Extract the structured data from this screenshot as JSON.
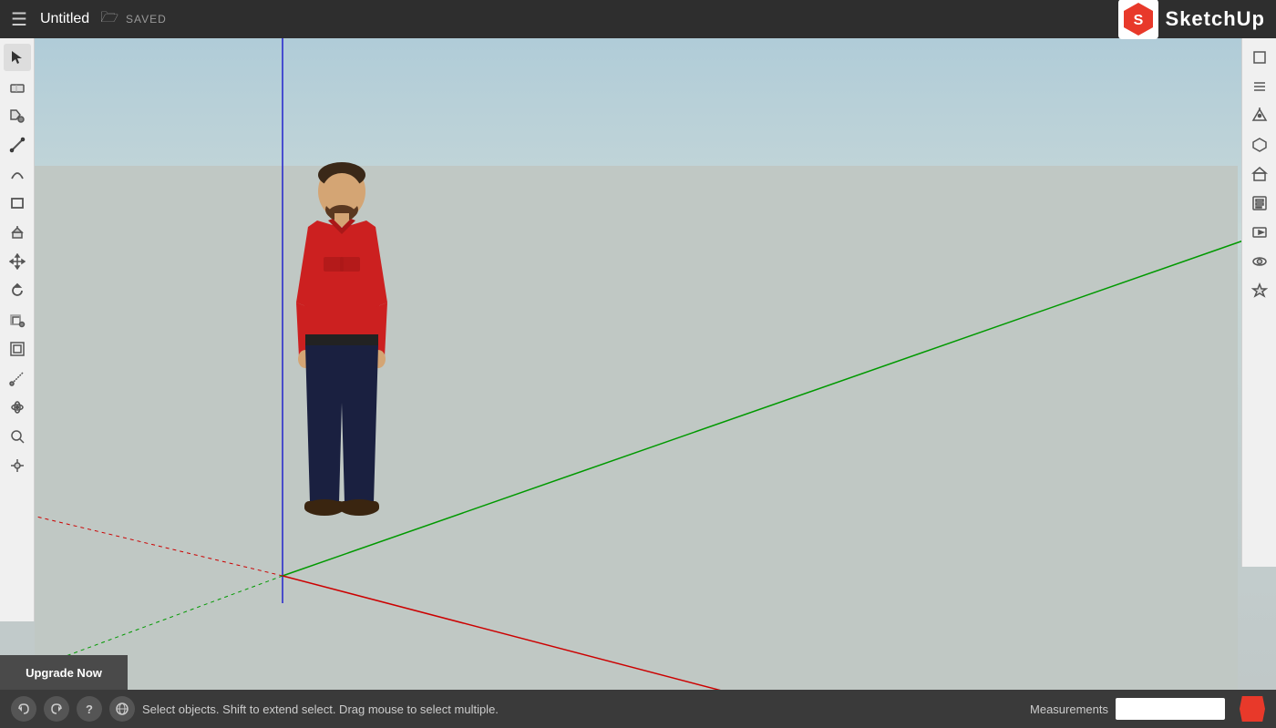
{
  "header": {
    "title": "Untitled",
    "saved_label": "SAVED",
    "logo_text": "SketchUp"
  },
  "toolbar_left": {
    "tools": [
      {
        "name": "select",
        "icon": "↖",
        "label": "Select"
      },
      {
        "name": "eraser",
        "icon": "◻",
        "label": "Eraser"
      },
      {
        "name": "paint",
        "icon": "⊙",
        "label": "Paint Bucket"
      },
      {
        "name": "line",
        "icon": "/",
        "label": "Line"
      },
      {
        "name": "arc",
        "icon": "⌒",
        "label": "Arc"
      },
      {
        "name": "rectangle",
        "icon": "⬜",
        "label": "Rectangle"
      },
      {
        "name": "push-pull",
        "icon": "⬆",
        "label": "Push/Pull"
      },
      {
        "name": "move",
        "icon": "✥",
        "label": "Move"
      },
      {
        "name": "rotate",
        "icon": "↻",
        "label": "Rotate"
      },
      {
        "name": "scale",
        "icon": "⤡",
        "label": "Scale"
      },
      {
        "name": "offset",
        "icon": "⊞",
        "label": "Offset"
      },
      {
        "name": "tape",
        "icon": "📏",
        "label": "Tape Measure"
      },
      {
        "name": "orbit",
        "icon": "⟳",
        "label": "Orbit"
      },
      {
        "name": "zoom",
        "icon": "🔍",
        "label": "Zoom"
      },
      {
        "name": "hand",
        "icon": "✋",
        "label": "Pan"
      }
    ]
  },
  "toolbar_right": {
    "tools": [
      {
        "name": "shape-tools",
        "icon": "◼",
        "label": "Shapes"
      },
      {
        "name": "layers",
        "icon": "≡",
        "label": "Layers"
      },
      {
        "name": "graduation",
        "icon": "🎓",
        "label": "Components"
      },
      {
        "name": "box",
        "icon": "⬡",
        "label": "3D Warehouse"
      },
      {
        "name": "house",
        "icon": "⌂",
        "label": "Extension Warehouse"
      },
      {
        "name": "stack",
        "icon": "◫",
        "label": "Entity Info"
      },
      {
        "name": "film",
        "icon": "🎬",
        "label": "Scenes"
      },
      {
        "name": "glasses",
        "icon": "👓",
        "label": "View"
      },
      {
        "name": "style",
        "icon": "🎨",
        "label": "Styles"
      }
    ]
  },
  "bottom_bar": {
    "status_text": "Select objects. Shift to extend select. Drag mouse to select multiple.",
    "measurements_label": "Measurements",
    "measurements_value": ""
  },
  "upgrade_btn": {
    "label": "Upgrade Now"
  },
  "axes": {
    "red_color": "#cc0000",
    "green_color": "#00aa00",
    "blue_color": "#0000cc"
  }
}
